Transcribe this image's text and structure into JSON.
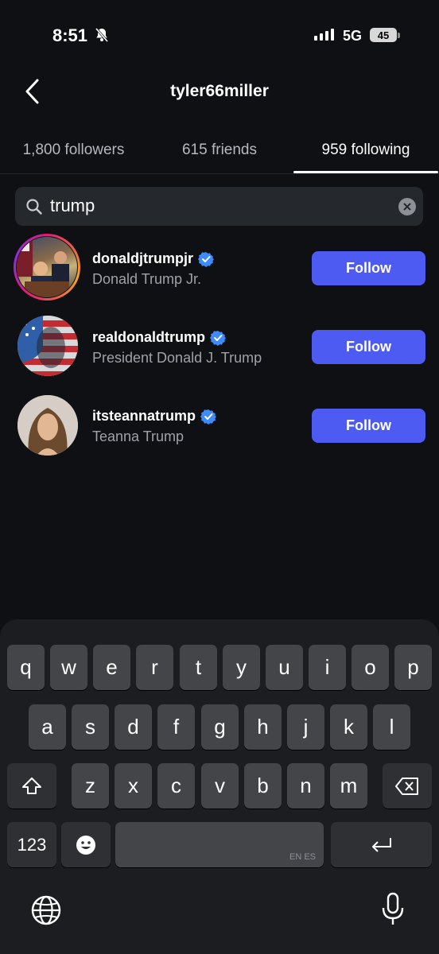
{
  "status_bar": {
    "time": "8:51",
    "network": "5G",
    "battery": "45"
  },
  "header": {
    "title": "tyler66miller"
  },
  "tabs": [
    {
      "label": "1,800 followers",
      "active": false
    },
    {
      "label": "615 friends",
      "active": false
    },
    {
      "label": "959 following",
      "active": true
    }
  ],
  "search": {
    "value": "trump"
  },
  "results": [
    {
      "username": "donaldjtrumpjr",
      "name": "Donald Trump Jr.",
      "verified": true,
      "button": "Follow"
    },
    {
      "username": "realdonaldtrump",
      "name": "President Donald J. Trump",
      "verified": true,
      "button": "Follow"
    },
    {
      "username": "itsteannatrump",
      "name": "Teanna Trump",
      "verified": true,
      "button": "Follow"
    }
  ],
  "keyboard": {
    "row1": [
      "q",
      "w",
      "e",
      "r",
      "t",
      "y",
      "u",
      "i",
      "o",
      "p"
    ],
    "row2": [
      "a",
      "s",
      "d",
      "f",
      "g",
      "h",
      "j",
      "k",
      "l"
    ],
    "row3": [
      "z",
      "x",
      "c",
      "v",
      "b",
      "n",
      "m"
    ],
    "numbers_key": "123",
    "space_hint": "EN ES"
  },
  "colors": {
    "accent": "#4e5bf3",
    "background": "#0e1013",
    "verified": "#3d8bfd"
  }
}
